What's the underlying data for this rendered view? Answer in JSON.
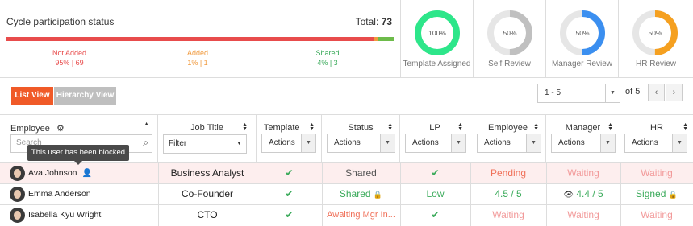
{
  "summary": {
    "title": "Cycle participation status",
    "total_label": "Total:",
    "total_value": "73",
    "segments": [
      {
        "label": "Not Added",
        "stats": "95% | 69",
        "percent": 95,
        "color": "#e84c4c"
      },
      {
        "label": "Added",
        "stats": "1% | 1",
        "percent": 1,
        "color": "#f09a3e"
      },
      {
        "label": "Shared",
        "stats": "4% | 3",
        "percent": 4,
        "color": "#6dbb4a"
      }
    ]
  },
  "gauges": [
    {
      "value_text": "100%",
      "percent": 100,
      "label": "Template Assigned",
      "color": "#2de68a"
    },
    {
      "value_text": "50%",
      "percent": 50,
      "label": "Self Review",
      "color": "#c0c0c0"
    },
    {
      "value_text": "50%",
      "percent": 50,
      "label": "Manager Review",
      "color": "#3b8ff0"
    },
    {
      "value_text": "50%",
      "percent": 50,
      "label": "HR Review",
      "color": "#f5a020"
    }
  ],
  "toolbar": {
    "list_view": "List View",
    "hierarchy_view": "Hierarchy View",
    "page_range": "1 - 5",
    "of_label": "of 5",
    "prev_icon": "‹",
    "next_icon": "›"
  },
  "table": {
    "headers": {
      "employee": "Employee",
      "job_title": "Job Title",
      "template": "Template",
      "status": "Status",
      "lp": "LP",
      "employee_review": "Employee",
      "manager": "Manager",
      "hr": "HR"
    },
    "filters": {
      "search_placeholder": "Search",
      "job_title_filter": "Filter",
      "actions": "Actions"
    },
    "tooltip": "This user has been blocked",
    "rows": [
      {
        "name": "Ava Johnson",
        "job_title": "Business Analyst",
        "template": "✔",
        "status": "Shared",
        "lp": "✔",
        "employee": "Pending",
        "manager": "Waiting",
        "hr": "Waiting",
        "blocked": true
      },
      {
        "name": "Emma Anderson",
        "job_title": "Co-Founder",
        "template": "✔",
        "status": "Shared",
        "lp": "Low",
        "employee": "4.5 / 5",
        "manager": "4.4 / 5",
        "hr": "Signed"
      },
      {
        "name": "Isabella Kyu Wright",
        "job_title": "CTO",
        "template": "✔",
        "status": "Awaiting Mgr In...",
        "lp": "✔",
        "employee": "Waiting",
        "manager": "Waiting",
        "hr": "Waiting"
      }
    ]
  }
}
